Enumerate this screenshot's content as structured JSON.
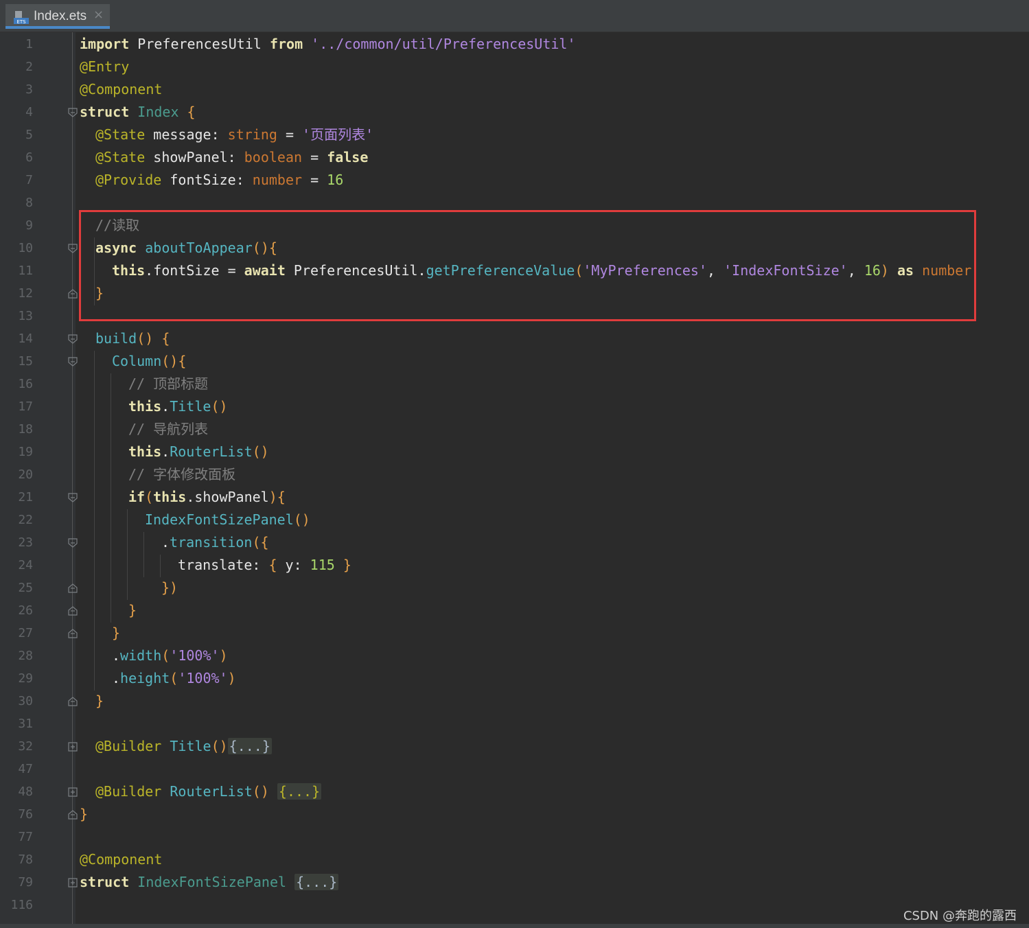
{
  "tab": {
    "filename": "Index.ets",
    "icon": "ets-file-icon",
    "icon_text": "ETS",
    "close": "×"
  },
  "line_numbers": [
    "1",
    "2",
    "3",
    "4",
    "5",
    "6",
    "7",
    "8",
    "9",
    "10",
    "11",
    "12",
    "13",
    "14",
    "15",
    "16",
    "17",
    "18",
    "19",
    "20",
    "21",
    "22",
    "23",
    "24",
    "25",
    "26",
    "27",
    "28",
    "29",
    "30",
    "31",
    "32",
    "47",
    "48",
    "76",
    "77",
    "78",
    "79",
    "116"
  ],
  "code": {
    "l1": {
      "a": "import",
      "b": " PreferencesUtil ",
      "c": "from",
      "d": " '../common/util/PreferencesUtil'"
    },
    "l2": {
      "a": "@Entry"
    },
    "l3": {
      "a": "@Component"
    },
    "l4": {
      "a": "struct",
      "b": " Index",
      "c": " {"
    },
    "l5": {
      "a": "@State",
      "b": " message",
      "c": ": ",
      "d": "string",
      "e": " = ",
      "f": "'页面列表'"
    },
    "l6": {
      "a": "@State",
      "b": " showPanel",
      "c": ": ",
      "d": "boolean",
      "e": " = ",
      "f": "false"
    },
    "l7": {
      "a": "@Provide",
      "b": " fontSize",
      "c": ": ",
      "d": "number",
      "e": " = ",
      "f": "16"
    },
    "l9": {
      "a": "//读取"
    },
    "l10": {
      "a": "async",
      "b": " aboutToAppear",
      "c": "()",
      "d": "{"
    },
    "l11": {
      "a": "this",
      "b": ".fontSize = ",
      "c": "await",
      "d": " PreferencesUtil.",
      "e": "getPreferenceValue",
      "f": "(",
      "g": "'MyPreferences'",
      "h": ", ",
      "i": "'IndexFontSize'",
      "j": ", ",
      "k": "16",
      "l": ")",
      "m": " as",
      "n": " number"
    },
    "l12": {
      "a": "}"
    },
    "l14": {
      "a": "build",
      "b": "()",
      "c": " {"
    },
    "l15": {
      "a": "Column",
      "b": "()",
      "c": "{"
    },
    "l16": {
      "a": "// 顶部标题"
    },
    "l17": {
      "a": "this",
      "b": ".",
      "c": "Title",
      "d": "()"
    },
    "l18": {
      "a": "// 导航列表"
    },
    "l19": {
      "a": "this",
      "b": ".",
      "c": "RouterList",
      "d": "()"
    },
    "l20": {
      "a": "// 字体修改面板"
    },
    "l21": {
      "a": "if",
      "b": "(",
      "c": "this",
      "d": ".showPanel",
      "e": ")",
      "f": "{"
    },
    "l22": {
      "a": "IndexFontSizePanel",
      "b": "()"
    },
    "l23": {
      "a": ".",
      "b": "transition",
      "c": "(",
      "d": "{"
    },
    "l24": {
      "a": "translate: ",
      "b": "{",
      "c": " y: ",
      "d": "115",
      "e": " }"
    },
    "l25": {
      "a": "}",
      "b": ")"
    },
    "l26": {
      "a": "}"
    },
    "l27": {
      "a": "}"
    },
    "l28": {
      "a": ".",
      "b": "width",
      "c": "(",
      "d": "'100%'",
      "e": ")"
    },
    "l29": {
      "a": ".",
      "b": "height",
      "c": "(",
      "d": "'100%'",
      "e": ")"
    },
    "l30": {
      "a": "}"
    },
    "l32": {
      "a": "@Builder",
      "b": " Title",
      "c": "()",
      "d": "{...}"
    },
    "l48": {
      "a": "@Builder",
      "b": " RouterList",
      "c": "()",
      "d": " ",
      "e": "{...}"
    },
    "l76": {
      "a": "}"
    },
    "l78": {
      "a": "@Component"
    },
    "l79": {
      "a": "struct",
      "b": " IndexFontSizePanel",
      "c": " ",
      "d": "{...}"
    }
  },
  "watermark": "CSDN @奔跑的露西",
  "colors": {
    "background": "#2b2b2b",
    "highlight": "#e03c3c",
    "keyword": "#e8e3b0",
    "annotation": "#bbb529",
    "string": "#b087e0",
    "number": "#a9d76a",
    "function": "#56b6c2"
  }
}
